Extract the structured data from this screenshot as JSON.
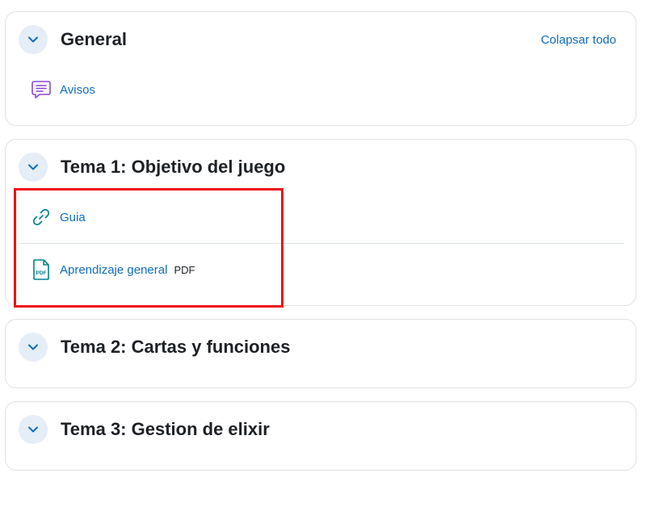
{
  "sections": {
    "general": {
      "title": "General",
      "collapse_all_label": "Colapsar todo",
      "activities": [
        {
          "label": "Avisos",
          "icon": "forum-icon"
        }
      ]
    },
    "tema1": {
      "title": "Tema 1: Objetivo del juego",
      "activities": [
        {
          "label": "Guia",
          "icon": "link-icon"
        },
        {
          "label": "Aprendizaje general",
          "badge": "PDF",
          "icon": "pdf-icon"
        }
      ]
    },
    "tema2": {
      "title": "Tema 2: Cartas y funciones"
    },
    "tema3": {
      "title": "Tema 3: Gestion de elixir"
    }
  },
  "colors": {
    "link": "#0f6cbf",
    "chevron_bg": "#e5edf7",
    "forum_icon": "#8a46e0",
    "resource_icon": "#00838f",
    "highlight_border": "#ee1111"
  }
}
